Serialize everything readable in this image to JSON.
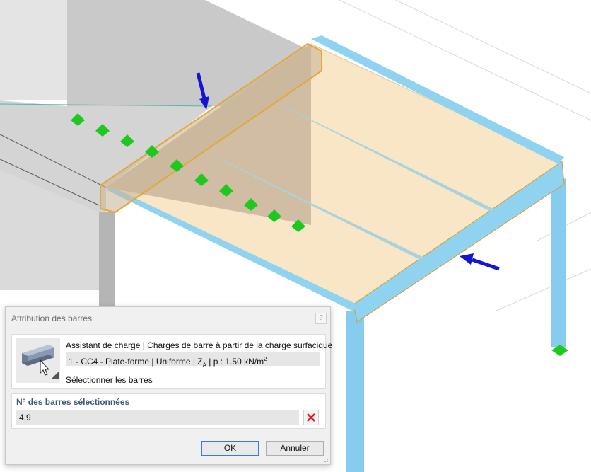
{
  "dialog": {
    "title": "Attribution des barres",
    "close_label": "?",
    "load_wizard": {
      "header": "Assistant de charge | Charges de barre à partir de la charge surfacique",
      "load_case_main": "1 - CC4 - Plate-forme | Uniforme | Z",
      "load_case_axis_sub": "A",
      "load_case_tail": " | p : 1.50 kN/m",
      "load_case_exponent": "2",
      "select_members_label": "Sélectionner les barres",
      "icon": "steel-beam-cursor-icon"
    },
    "selection": {
      "label": "N° des barres sélectionnées",
      "value": "4,9",
      "clear_icon": "red-x-icon"
    },
    "buttons": {
      "ok": "OK",
      "cancel": "Annuler"
    }
  },
  "viewport": {
    "content": "3d-structure-view",
    "arrow_icon": "blue-arrow-icon",
    "colors": {
      "slab": "#f7e7c9",
      "member": "#8fd0ee",
      "selected": "#e5a733",
      "support": "#1ec81e",
      "arrow": "#1414d4",
      "wall": "#d6d6d6"
    }
  }
}
